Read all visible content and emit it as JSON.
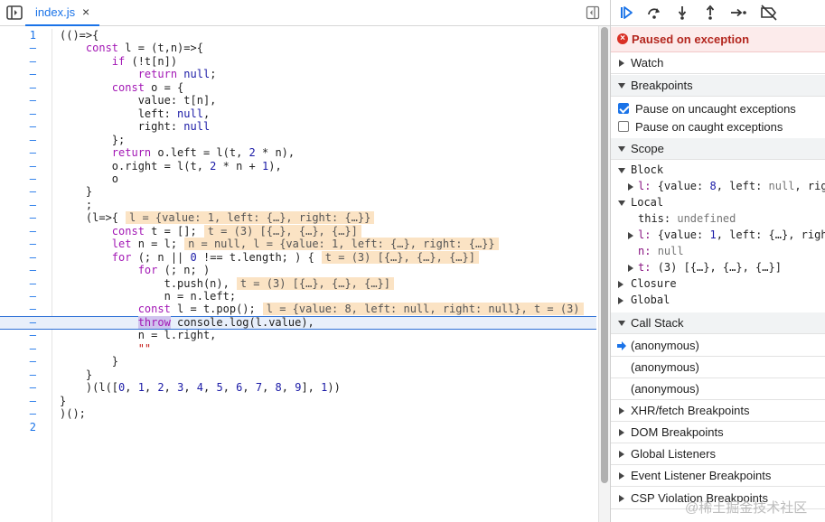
{
  "editor": {
    "tab_label": "index.js",
    "tab_close": "×"
  },
  "code_lines": [
    {
      "ln": "1",
      "html": "(()=>{"
    },
    {
      "ln": "–",
      "html": "    <span class=\"kw\">const</span> l = (t,n)=>{"
    },
    {
      "ln": "–",
      "html": "        <span class=\"kw\">if</span> (!t[n])"
    },
    {
      "ln": "–",
      "html": "            <span class=\"kw\">return</span> <span class=\"lit\">null</span>;"
    },
    {
      "ln": "–",
      "html": "        <span class=\"kw\">const</span> o = {"
    },
    {
      "ln": "–",
      "html": "            value: t[n],"
    },
    {
      "ln": "–",
      "html": "            left: <span class=\"lit\">null</span>,"
    },
    {
      "ln": "–",
      "html": "            right: <span class=\"lit\">null</span>"
    },
    {
      "ln": "–",
      "html": "        };"
    },
    {
      "ln": "–",
      "html": "        <span class=\"kw\">return</span> o.left = l(t, <span class=\"num\">2</span> * n),"
    },
    {
      "ln": "–",
      "html": "        o.right = l(t, <span class=\"num\">2</span> * n + <span class=\"num\">1</span>),"
    },
    {
      "ln": "–",
      "html": "        o"
    },
    {
      "ln": "–",
      "html": "    }"
    },
    {
      "ln": "–",
      "html": "    ;"
    },
    {
      "ln": "–",
      "html": "    (l=>{<span class=\"inline-val\">l = {value: 1, left: {…}, right: {…}}</span>"
    },
    {
      "ln": "–",
      "html": "        <span class=\"kw\">const</span> t = [];<span class=\"inline-val\">t = (3) [{…}, {…}, {…}]</span>"
    },
    {
      "ln": "–",
      "html": "        <span class=\"kw\">let</span> n = l;<span class=\"inline-val\">n = null, l = {value: 1, left: {…}, right: {…}}</span>"
    },
    {
      "ln": "–",
      "html": "        <span class=\"kw\">for</span> (; n || <span class=\"num\">0</span> !== t.length; ) {<span class=\"inline-val\">t = (3) [{…}, {…}, {…}]</span>"
    },
    {
      "ln": "–",
      "html": "            <span class=\"kw\">for</span> (; n; )"
    },
    {
      "ln": "–",
      "html": "                t.push(n),<span class=\"inline-val\">t = (3) [{…}, {…}, {…}]</span>"
    },
    {
      "ln": "–",
      "html": "                n = n.left;"
    },
    {
      "ln": "–",
      "html": "            <span class=\"kw\">const</span> l = t.pop();<span class=\"inline-val\">l = {value: 8, left: null, right: null}, t = (3)</span>"
    },
    {
      "ln": "–",
      "html": "            <span class=\"exc-kw\">throw</span> console.log(l.value),",
      "current": true
    },
    {
      "ln": "–",
      "html": "            n = l.right,"
    },
    {
      "ln": "–",
      "html": "            <span class=\"str\">\"\"</span>"
    },
    {
      "ln": "–",
      "html": "        }"
    },
    {
      "ln": "–",
      "html": "    }"
    },
    {
      "ln": "–",
      "html": "    )(l([<span class=\"num\">0</span>, <span class=\"num\">1</span>, <span class=\"num\">2</span>, <span class=\"num\">3</span>, <span class=\"num\">4</span>, <span class=\"num\">5</span>, <span class=\"num\">6</span>, <span class=\"num\">7</span>, <span class=\"num\">8</span>, <span class=\"num\">9</span>], <span class=\"num\">1</span>))"
    },
    {
      "ln": "–",
      "html": "}"
    },
    {
      "ln": "–",
      "html": ")();"
    },
    {
      "ln": "2",
      "html": ""
    }
  ],
  "debugger": {
    "exception_banner": "Paused on exception",
    "watch": "Watch",
    "breakpoints": "Breakpoints",
    "pause_uncaught": "Pause on uncaught exceptions",
    "pause_uncaught_checked": true,
    "pause_caught": "Pause on caught exceptions",
    "pause_caught_checked": false,
    "scope": "Scope",
    "scope_rows": [
      {
        "depth": 0,
        "tri": "down",
        "html": "Block"
      },
      {
        "depth": 1,
        "tri": "right",
        "html": "<span class=\"s-key\">l:</span> <span class=\"s-val\">{value: <span class=\"s-num\">8</span>, left: <span class=\"s-null\">null</span>, rig</span>"
      },
      {
        "depth": 0,
        "tri": "down",
        "html": "Local"
      },
      {
        "depth": 2,
        "tri": "",
        "html": "<span class=\"s-val\">this: <span class=\"s-null\">undefined</span></span>"
      },
      {
        "depth": 1,
        "tri": "right",
        "html": "<span class=\"s-key\">l:</span> <span class=\"s-val\">{value: <span class=\"s-num\">1</span>, left: {…}, righ</span>"
      },
      {
        "depth": 2,
        "tri": "",
        "html": "<span class=\"s-key\">n:</span> <span class=\"s-null\">null</span>"
      },
      {
        "depth": 1,
        "tri": "right",
        "html": "<span class=\"s-key\">t:</span> <span class=\"s-val\">(3) [{…}, {…}, {…}]</span>"
      },
      {
        "depth": 0,
        "tri": "right",
        "html": "Closure"
      },
      {
        "depth": 0,
        "tri": "right",
        "html": "Global"
      }
    ],
    "call_stack": "Call Stack",
    "frames": [
      "(anonymous)",
      "(anonymous)",
      "(anonymous)"
    ],
    "xhr": "XHR/fetch Breakpoints",
    "dom": "DOM Breakpoints",
    "global_listeners": "Global Listeners",
    "event_listener": "Event Listener Breakpoints",
    "csp": "CSP Violation Breakpoints"
  },
  "watermark": "@稀土掘金技术社区"
}
